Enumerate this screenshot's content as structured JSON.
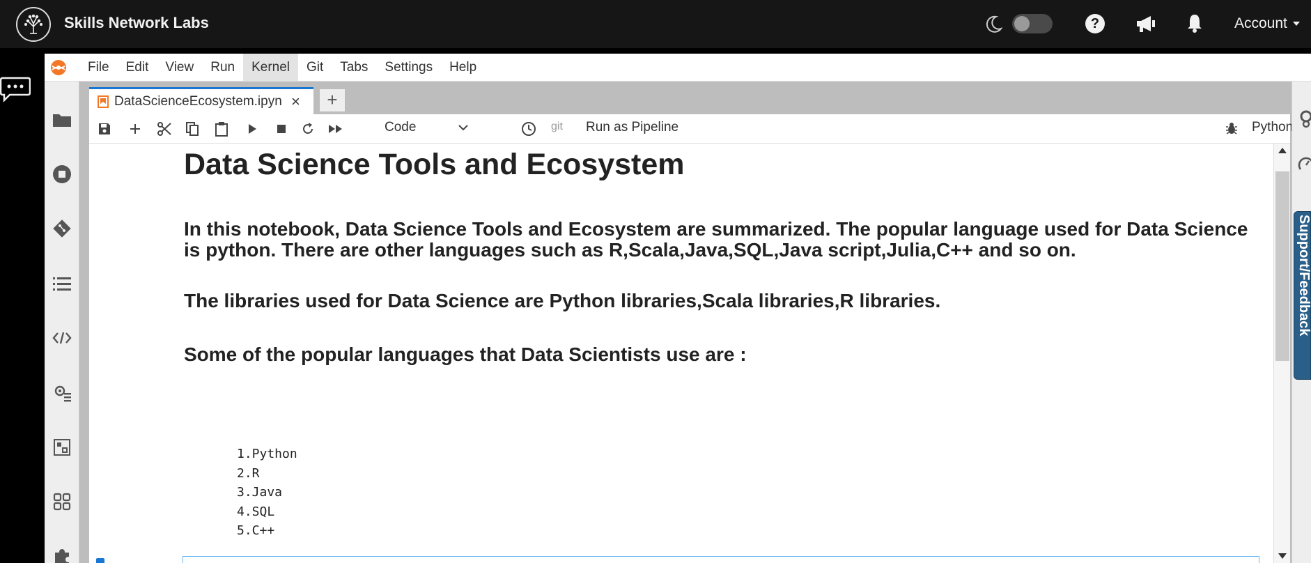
{
  "header": {
    "brand": "Skills Network Labs",
    "account_label": "Account",
    "help_label": "?"
  },
  "menubar": {
    "items": [
      "File",
      "Edit",
      "View",
      "Run",
      "Kernel",
      "Git",
      "Tabs",
      "Settings",
      "Help"
    ],
    "active": "Kernel"
  },
  "tabs": {
    "active_label": "DataScienceEcosystem.ipyn",
    "new_tab_label": "+",
    "close_label": "×"
  },
  "toolbar": {
    "cell_type": "Code",
    "git_label": "git",
    "pipeline_label": "Run as Pipeline",
    "kernel_name": "Python"
  },
  "notebook": {
    "title": "Data Science Tools and Ecosystem",
    "intro": "In this notebook, Data Science Tools and Ecosystem are summarized. The popular language used for Data Science is python. There are other languages such as R,Scala,Java,SQL,Java script,Julia,C++ and so on.",
    "libraries": "The libraries used for Data Science are Python libraries,Scala libraries,R libraries.",
    "languages_heading": "Some of the popular languages that Data Scientists use are :",
    "language_list": [
      "1.Python",
      "2.R",
      "3.Java",
      "4.SQL",
      "5.C++"
    ]
  },
  "right_sidebar": {
    "support_label": "Support/Feedback"
  },
  "colors": {
    "header_bg": "#161616",
    "accent": "#1976d2",
    "support_tab": "#2a5f8a"
  }
}
